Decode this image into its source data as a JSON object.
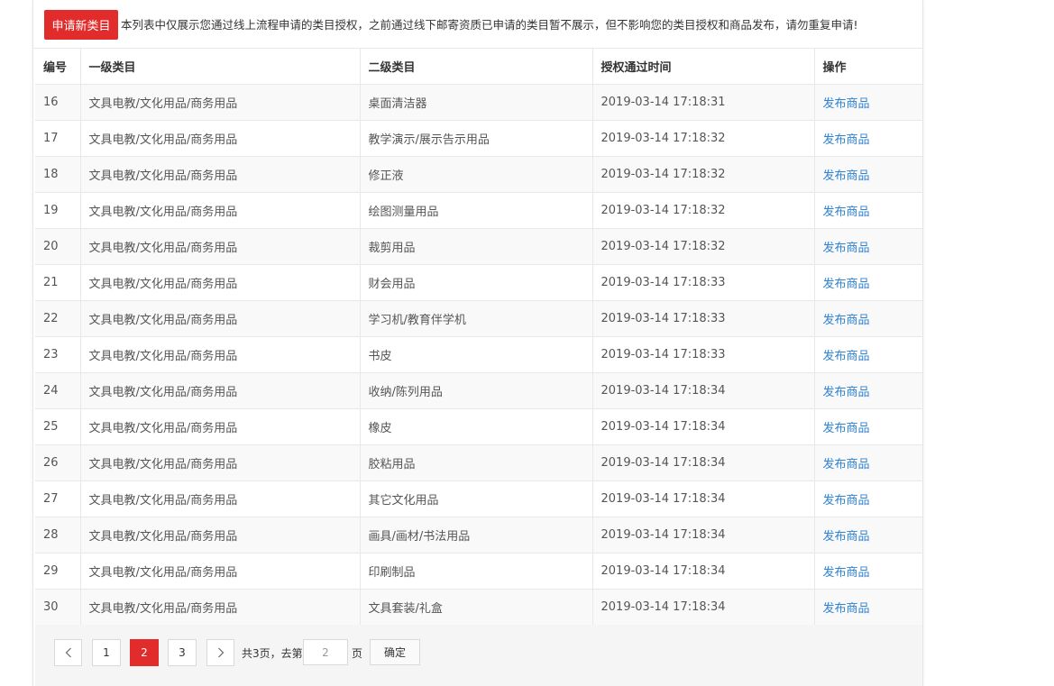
{
  "toolbar": {
    "apply_label": "申请新类目",
    "notice": "本列表中仅展示您通过线上流程申请的类目授权，之前通过线下邮寄资质已申请的类目暂不展示，但不影响您的类目授权和商品发布，请勿重复申请!"
  },
  "table": {
    "columns": [
      "编号",
      "一级类目",
      "二级类目",
      "授权通过时间",
      "操作"
    ],
    "rows": [
      {
        "id": "16",
        "level1": "文具电教/文化用品/商务用品",
        "level2": "桌面清洁器",
        "time": "2019-03-14 17:18:31",
        "action": "发布商品"
      },
      {
        "id": "17",
        "level1": "文具电教/文化用品/商务用品",
        "level2": "教学演示/展示告示用品",
        "time": "2019-03-14 17:18:32",
        "action": "发布商品"
      },
      {
        "id": "18",
        "level1": "文具电教/文化用品/商务用品",
        "level2": "修正液",
        "time": "2019-03-14 17:18:32",
        "action": "发布商品"
      },
      {
        "id": "19",
        "level1": "文具电教/文化用品/商务用品",
        "level2": "绘图测量用品",
        "time": "2019-03-14 17:18:32",
        "action": "发布商品"
      },
      {
        "id": "20",
        "level1": "文具电教/文化用品/商务用品",
        "level2": "裁剪用品",
        "time": "2019-03-14 17:18:32",
        "action": "发布商品"
      },
      {
        "id": "21",
        "level1": "文具电教/文化用品/商务用品",
        "level2": "财会用品",
        "time": "2019-03-14 17:18:33",
        "action": "发布商品"
      },
      {
        "id": "22",
        "level1": "文具电教/文化用品/商务用品",
        "level2": "学习机/教育伴学机",
        "time": "2019-03-14 17:18:33",
        "action": "发布商品"
      },
      {
        "id": "23",
        "level1": "文具电教/文化用品/商务用品",
        "level2": "书皮",
        "time": "2019-03-14 17:18:33",
        "action": "发布商品"
      },
      {
        "id": "24",
        "level1": "文具电教/文化用品/商务用品",
        "level2": "收纳/陈列用品",
        "time": "2019-03-14 17:18:34",
        "action": "发布商品"
      },
      {
        "id": "25",
        "level1": "文具电教/文化用品/商务用品",
        "level2": "橡皮",
        "time": "2019-03-14 17:18:34",
        "action": "发布商品"
      },
      {
        "id": "26",
        "level1": "文具电教/文化用品/商务用品",
        "level2": "胶粘用品",
        "time": "2019-03-14 17:18:34",
        "action": "发布商品"
      },
      {
        "id": "27",
        "level1": "文具电教/文化用品/商务用品",
        "level2": "其它文化用品",
        "time": "2019-03-14 17:18:34",
        "action": "发布商品"
      },
      {
        "id": "28",
        "level1": "文具电教/文化用品/商务用品",
        "level2": "画具/画材/书法用品",
        "time": "2019-03-14 17:18:34",
        "action": "发布商品"
      },
      {
        "id": "29",
        "level1": "文具电教/文化用品/商务用品",
        "level2": "印刷制品",
        "time": "2019-03-14 17:18:34",
        "action": "发布商品"
      },
      {
        "id": "30",
        "level1": "文具电教/文化用品/商务用品",
        "level2": "文具套装/礼盒",
        "time": "2019-03-14 17:18:34",
        "action": "发布商品"
      }
    ]
  },
  "pagination": {
    "pages": [
      "1",
      "2",
      "3"
    ],
    "current": "2",
    "total_text": "共3页，去第",
    "goto_value": "2",
    "unit": "页",
    "confirm_label": "确定",
    "prev_icon": "chevron-left-icon",
    "next_icon": "chevron-right-icon"
  },
  "colors": {
    "accent": "#e22c2c",
    "link": "#2e82d0",
    "border": "#e8e8e8",
    "row_stripe": "#f9f9f9"
  }
}
